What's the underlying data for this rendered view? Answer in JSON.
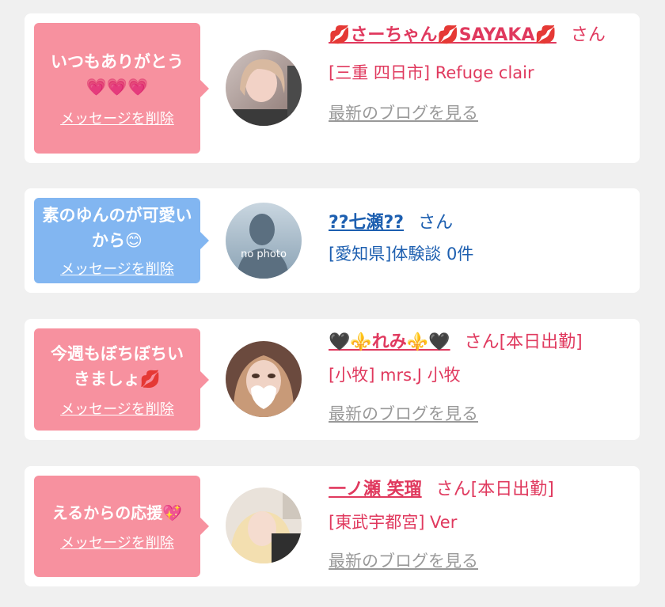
{
  "messages": [
    {
      "bubble_text": "いつもありがとう💗💗💗",
      "delete_label": "メッセージを削除",
      "name": "💋さーちゃん💋SAYAKA💋",
      "san": "さん",
      "shop": "[三重 四日市] Refuge clair",
      "blog_label": "最新のブログを見る"
    },
    {
      "bubble_text": "素のゆんのが可愛いから😊",
      "delete_label": "メッセージを削除",
      "name": "??七瀬??",
      "san": "さん",
      "shop": "[愛知県]体験談 0件",
      "avatar_placeholder": "no photo"
    },
    {
      "bubble_text": "今週もぼちぼちいきましょ💋",
      "delete_label": "メッセージを削除",
      "name": "🖤⚜️れみ⚜️🖤",
      "san": "さん[本日出勤]",
      "shop": "[小牧] mrs.J 小牧",
      "blog_label": "最新のブログを見る"
    },
    {
      "bubble_text": "えるからの応援💖",
      "delete_label": "メッセージを削除",
      "name": "一ノ瀬 笑瑠",
      "san": "さん[本日出勤]",
      "shop": "[東武宇都宮] Ver",
      "blog_label": "最新のブログを見る"
    }
  ],
  "colors": {
    "pink_bubble": "#f7919f",
    "blue_bubble": "#82b6f1",
    "pink_text": "#e0395e",
    "blue_text": "#1d5fb0"
  }
}
